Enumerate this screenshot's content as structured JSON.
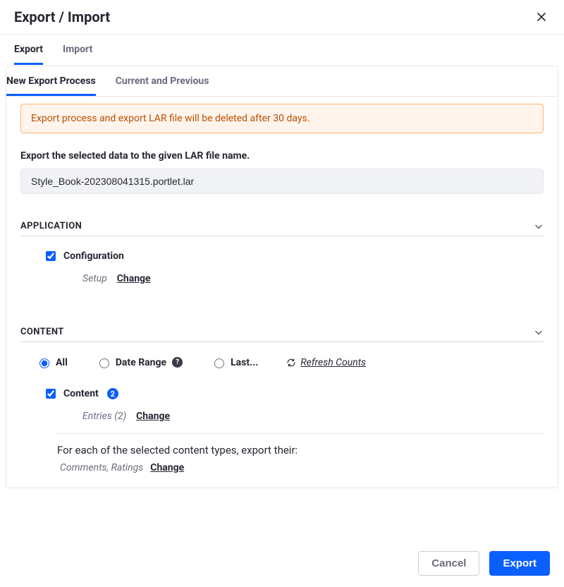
{
  "modal": {
    "title": "Export / Import"
  },
  "tabs_primary": {
    "export": "Export",
    "import": "Import"
  },
  "tabs_secondary": {
    "new_process": "New Export Process",
    "current_previous": "Current and Previous"
  },
  "alert": {
    "text": "Export process and export LAR file will be deleted after 30 days."
  },
  "filename": {
    "label": "Export the selected data to the given LAR file name.",
    "value": "Style_Book-202308041315.portlet.lar"
  },
  "groups": {
    "application": {
      "title": "APPLICATION",
      "configuration_label": "Configuration",
      "setup_label": "Setup",
      "change_label": "Change"
    },
    "content": {
      "title": "CONTENT",
      "radios": {
        "all": "All",
        "date_range": "Date Range",
        "last": "Last..."
      },
      "refresh_label": "Refresh Counts",
      "content_label": "Content",
      "content_count": "2",
      "entries_label": "Entries (2)",
      "entries_change": "Change",
      "types_note": "For each of the selected content types, export their:",
      "types_values": "Comments, Ratings",
      "types_change": "Change"
    }
  },
  "footer": {
    "cancel": "Cancel",
    "export": "Export"
  }
}
